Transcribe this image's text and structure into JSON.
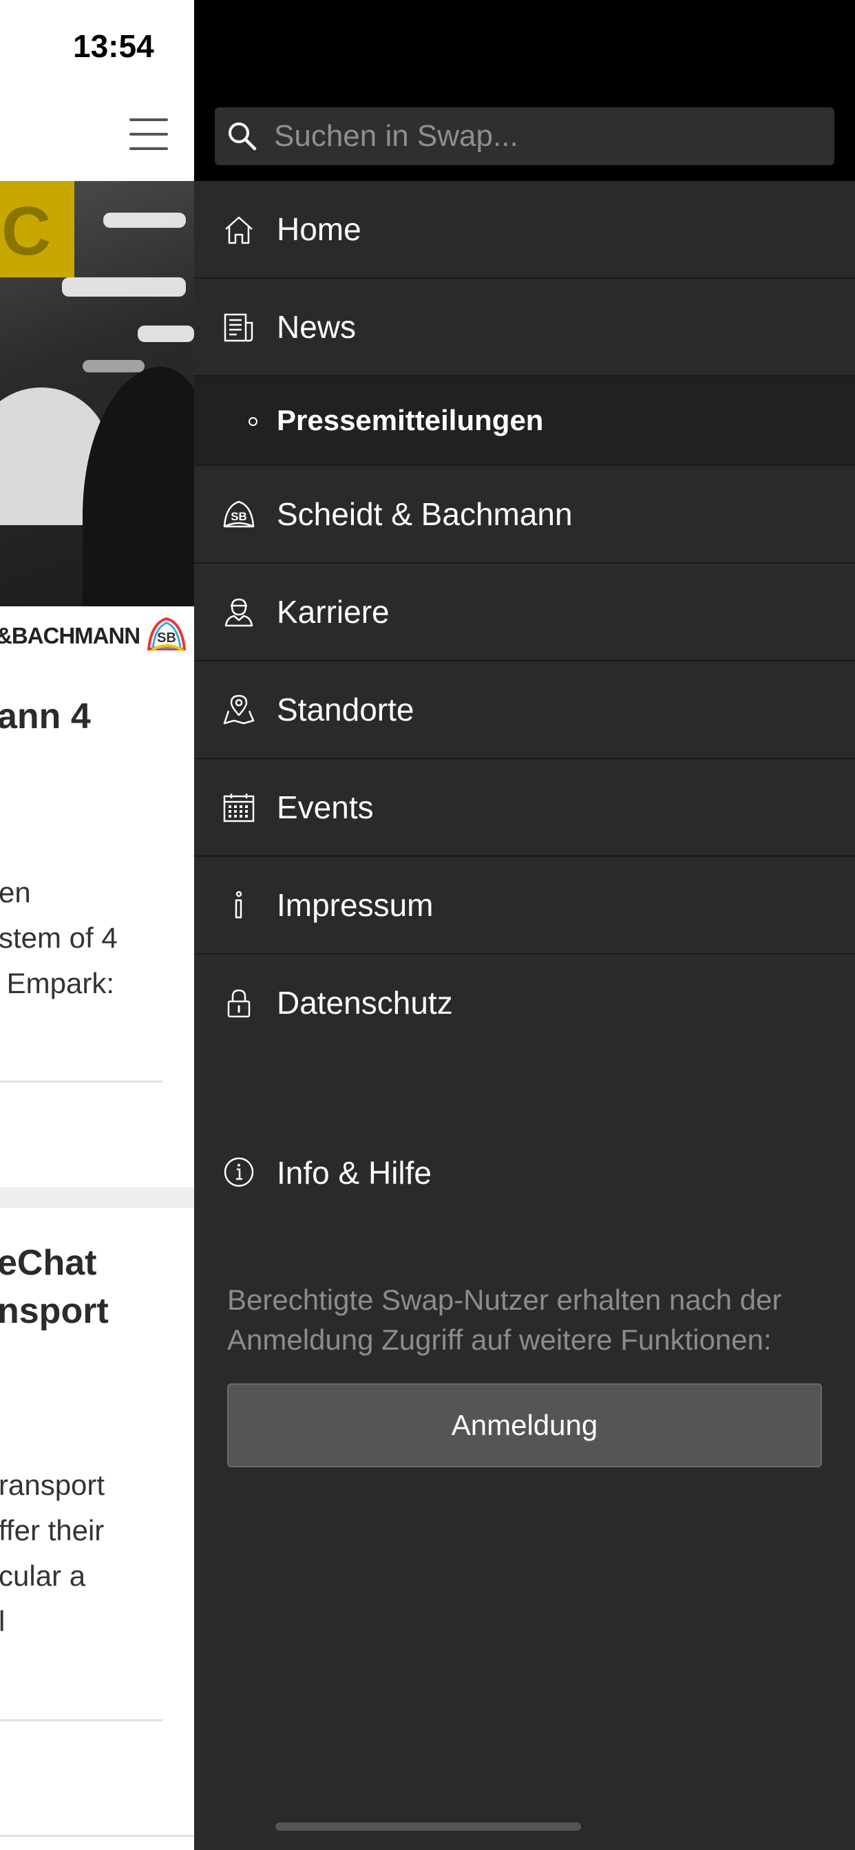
{
  "status_bar": {
    "time": "13:54"
  },
  "background_page": {
    "brand_text": "&BACHMANN",
    "articles": [
      {
        "title": "ann 4",
        "body": "en\nstem of 4\n Empark:"
      },
      {
        "title": "eChat\nnsport",
        "body": "ransport\nffer their\ncular a\nl"
      }
    ]
  },
  "drawer": {
    "search": {
      "placeholder": "Suchen in Swap...",
      "value": ""
    },
    "menu": [
      {
        "label": "Home",
        "icon": "home-icon"
      },
      {
        "label": "News",
        "icon": "newspaper-icon"
      },
      {
        "label": "Pressemitteilungen",
        "icon": "bullet-icon",
        "sub": true
      },
      {
        "label": "Scheidt & Bachmann",
        "icon": "sb-logo-icon"
      },
      {
        "label": "Karriere",
        "icon": "person-icon"
      },
      {
        "label": "Standorte",
        "icon": "map-pin-icon"
      },
      {
        "label": "Events",
        "icon": "calendar-icon"
      },
      {
        "label": "Impressum",
        "icon": "info-i-icon"
      },
      {
        "label": "Datenschutz",
        "icon": "lock-icon"
      }
    ],
    "info": {
      "label": "Info & Hilfe",
      "icon": "info-circle-icon"
    },
    "login_hint": "Berechtigte Swap-Nutzer erhalten nach der Anmeldung Zugriff auf weitere Funktionen:",
    "login_button": "Anmeldung"
  },
  "colors": {
    "drawer_bg": "#2a2a2a",
    "drawer_top": "#000000",
    "sub_item_bg": "#212121",
    "button_bg": "#555555",
    "hint_text": "#8c8c8c"
  }
}
